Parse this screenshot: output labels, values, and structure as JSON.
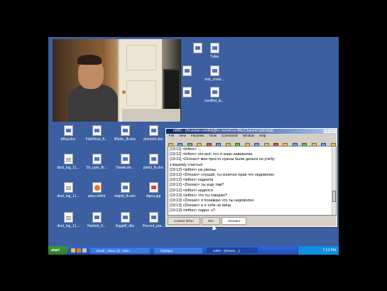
{
  "desktop": {
    "icons": [
      {
        "label": "",
        "kind": "doc"
      },
      {
        "label": "Tufas",
        "kind": "doc"
      },
      {
        "label": "",
        "kind": "doc"
      },
      {
        "label": "nnb_sover...",
        "kind": "doc"
      },
      {
        "label": "",
        "kind": "doc"
      },
      {
        "label": "nonffnd_bl...",
        "kind": "doc"
      },
      {
        "label": "bBuy.doc",
        "kind": "doc"
      },
      {
        "label": "FlatShow_fl...",
        "kind": "doc"
      },
      {
        "label": "fiNotic_fb.doc",
        "kind": "doc"
      },
      {
        "label": "phonefo.doc",
        "kind": "doc"
      },
      {
        "label": "dlod_log_11...",
        "kind": "txt"
      },
      {
        "label": "Sh_upts_fb...",
        "kind": "doc"
      },
      {
        "label": "Dandicde...",
        "kind": "doc"
      },
      {
        "label": "pfefol_fb.doc",
        "kind": "doc"
      },
      {
        "label": "dlod_log_11...",
        "kind": "txt"
      },
      {
        "label": "adso.shtml",
        "kind": "ff"
      },
      {
        "label": "rtaipbl_fb.doc",
        "kind": "doc"
      },
      {
        "label": "dqpur.jpg",
        "kind": "img"
      },
      {
        "label": "dlod_log_11...",
        "kind": "txt"
      },
      {
        "label": "fitarlotd_fl...",
        "kind": "doc"
      },
      {
        "label": "lloggbfl_dbc",
        "kind": "doc"
      },
      {
        "label": "Piscord_prp...",
        "kind": "doc"
      }
    ]
  },
  "mirc": {
    "title": "mIRC - [#russian-comlink@irc.rusnet.ru+MaxChannel.ru/mchat]",
    "menu": [
      "File",
      "View",
      "Favorites",
      "Tools",
      "Commands",
      "Window",
      "Help"
    ],
    "lines": [
      "[19:11] <lefton> ...",
      "[19:11] <lefton> это всё, что я знаю наверняка",
      "[19:11] <Dresan> мне просто нужны были деньги на учебу",
      "   к вашему счастью",
      "[19:12] <lefton> уж увольь",
      "[19:12] <Dresan> слушай, ты конечно прав что недоволен",
      "[19:12] <lefton> надоела",
      "[19:12] <Dresan> ты еще там?",
      "[19:12] <lefton> наделся",
      "[19:13] <lefton> что ты говорил?",
      "[19:13] <Dresan> я понимаю что ты недоволен",
      "[19:13] <Dresan> и я тебе не вина",
      "[19:13] <lefton> ладно. к?"
    ],
    "switchbar": [
      {
        "label": "Contact lefton",
        "active": false
      },
      {
        "label": "Stor",
        "active": false
      },
      {
        "label": "Otvetam",
        "active": true
      }
    ]
  },
  "taskbar": {
    "start_label": "start",
    "tasks": [
      {
        "label": "Email - Inbox (2) - Moz...",
        "active": false
      },
      {
        "label": "FlyMaps",
        "active": false
      },
      {
        "label": "mIRC - [Dresan ...]",
        "active": true
      }
    ],
    "clock": "7:12 PM"
  }
}
